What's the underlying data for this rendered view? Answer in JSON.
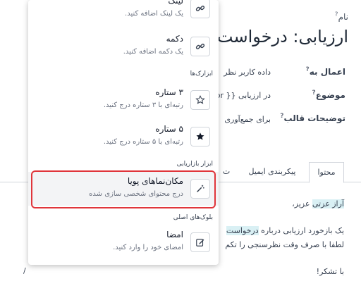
{
  "form": {
    "name_label": "نام",
    "help_mark": "?",
    "title": "ارزیابی: درخواست",
    "apply_to_label": "اعمال به",
    "apply_to_value": "داده کاربر نظر",
    "subject_label": "موضوع",
    "subject_value": "در ارزیابی {{ for",
    "template_desc_label": "توضیحات قالب",
    "template_desc_value": "برای جمع‌آوری"
  },
  "tabs": [
    {
      "label": "محتوا"
    },
    {
      "label": "پیکربندی ایمیل"
    },
    {
      "label": "ت"
    }
  ],
  "content": {
    "greeting_name": "آراز عزتی",
    "greeting_suffix": " عزیز،",
    "line1_a": "یک بازخورد ارزیابی درباره ",
    "line1_b": "درخواست",
    "line2": "لطفا با صرف وقت نظرسنجی را تکم",
    "thanks": "با تشکر!",
    "slash": "/"
  },
  "menu": {
    "items": [
      {
        "title": "لینک",
        "desc": "یک لینک اضافه کنید.",
        "icon": "link-icon"
      },
      {
        "title": "دکمه",
        "desc": "یک دکمه اضافه کنید.",
        "icon": "link-icon"
      },
      {
        "title": "۳ ستاره",
        "desc": "رتبه‌ای با ۳ ستاره درج کنید.",
        "icon": "star-outline-icon"
      },
      {
        "title": "۵ ستاره",
        "desc": "رتبه‌ای با ۵ ستاره درج کنید.",
        "icon": "star-filled-icon"
      },
      {
        "title": "مکان‌نماهای پویا",
        "desc": "درج محتوای شخصی سازی شده",
        "icon": "magic-wand-icon"
      },
      {
        "title": "امضا",
        "desc": "امضای خود را وارد کنید.",
        "icon": "pencil-square-icon"
      }
    ],
    "categories": {
      "tools": "ابزارک‌ها",
      "marketing": "ابزار بازاریابی",
      "basic_blocks": "بلوک‌های اصلی"
    }
  },
  "colors": {
    "highlight_border": "#e0353b",
    "text_highlight": "#d9f0f4"
  }
}
